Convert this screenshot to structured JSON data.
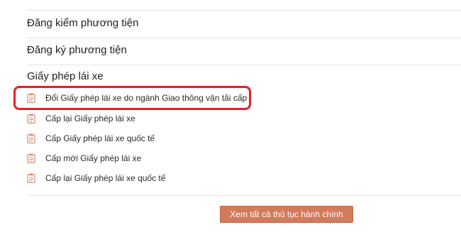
{
  "top_partial": "",
  "sections": [
    {
      "label": "Đăng kiểm phương tiện"
    },
    {
      "label": "Đăng ký phương tiện"
    },
    {
      "label": "Giấy phép lái xe"
    }
  ],
  "items": [
    {
      "label": "Đổi Giấy phép lái xe do ngành Giao thông vận tải cấp",
      "icon": "clipboard-icon"
    },
    {
      "label": "Cấp lại Giấy phép lái xe",
      "icon": "clipboard-icon"
    },
    {
      "label": "Cấp Giấy phép lái xe quốc tế",
      "icon": "clipboard-icon"
    },
    {
      "label": "Cấp mới Giấy phép lái xe",
      "icon": "clipboard-icon"
    },
    {
      "label": "Cấp lại Giấy phép lái xe quốc tế",
      "icon": "clipboard-icon"
    }
  ],
  "cta": {
    "label": "Xem tất cả thủ tục hành chính"
  },
  "colors": {
    "accent": "#d27a5c",
    "highlight": "#e2202a",
    "icon": "#d9896b"
  }
}
